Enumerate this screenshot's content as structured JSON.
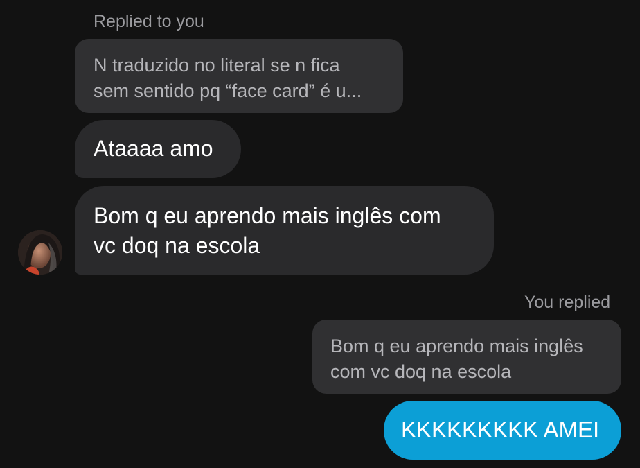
{
  "conversation": {
    "incoming": {
      "reply_label": "Replied to you",
      "quoted_message": {
        "line1": "N traduzido no literal se n fica",
        "line2": "sem sentido pq “face card” é u..."
      },
      "messages": [
        {
          "lines": [
            "Ataaaa amo"
          ]
        },
        {
          "lines": [
            "Bom q eu aprendo mais inglês com",
            "vc doq na escola"
          ]
        }
      ],
      "avatar_icon": "profile-avatar-icon"
    },
    "outgoing": {
      "reply_label": "You replied",
      "quoted_message": {
        "line1": "Bom q eu aprendo mais inglês",
        "line2": "com vc doq na escola"
      },
      "message": "KKKKKKKKK AMEI"
    }
  },
  "colors": {
    "background": "#121212",
    "incoming_bubble": "#2a2a2c",
    "quote_bubble": "#303032",
    "outgoing_bubble": "#0c9fd6",
    "meta_text": "#9b9b9f"
  }
}
